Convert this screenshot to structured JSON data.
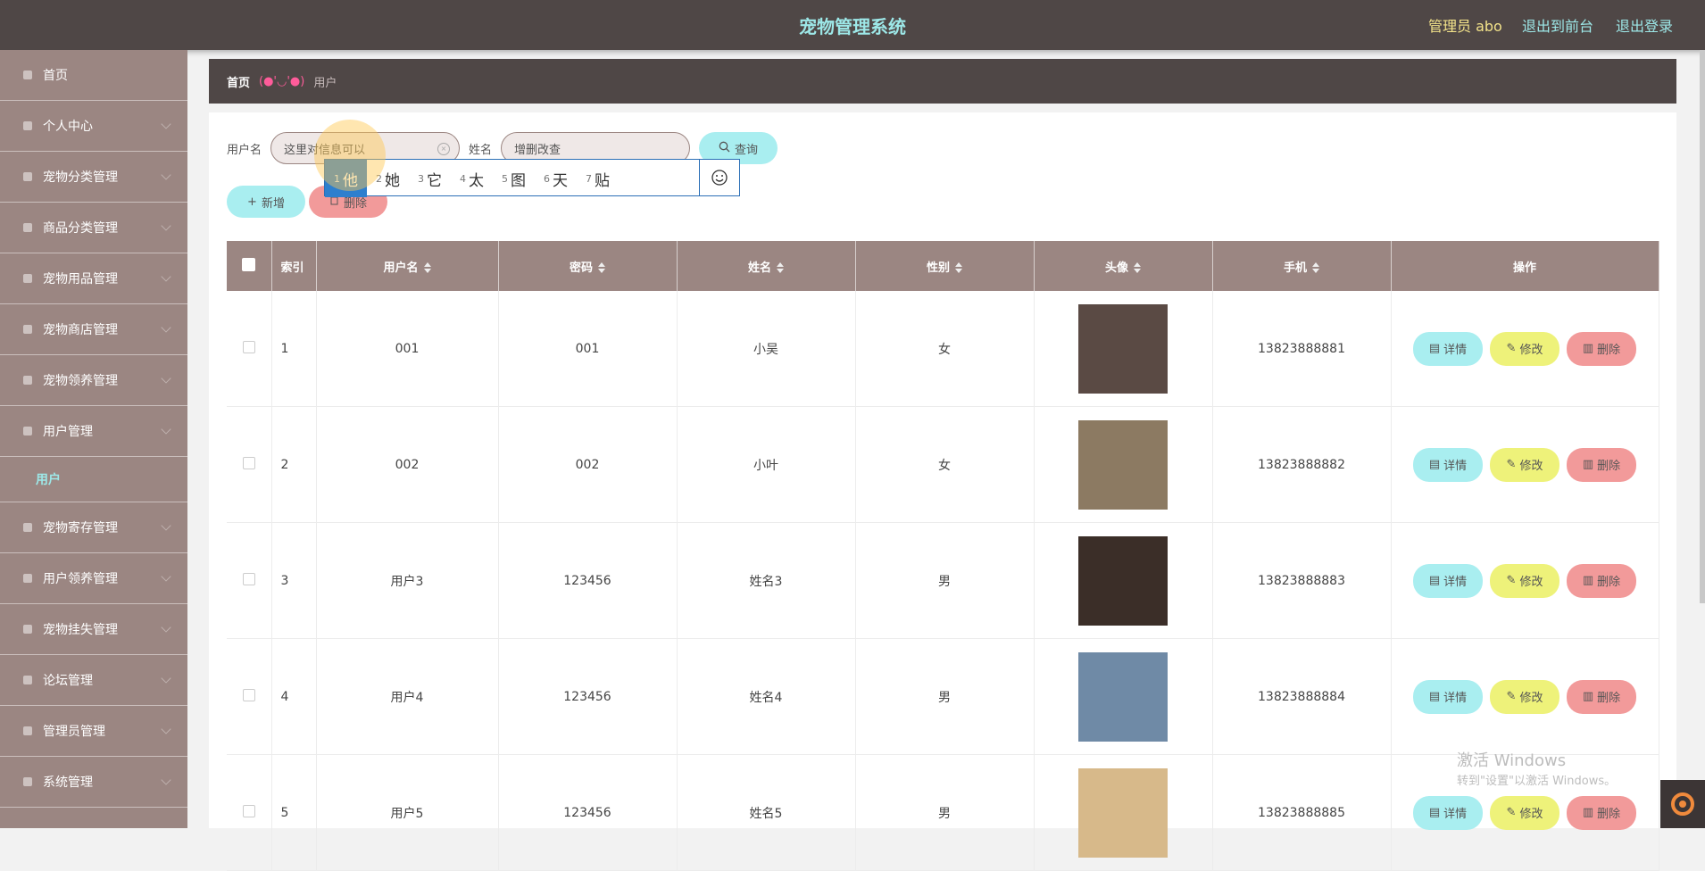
{
  "header": {
    "title": "宠物管理系统",
    "admin_label": "管理员 abo",
    "front_link": "退出到前台",
    "logout_link": "退出登录"
  },
  "sidebar": {
    "items": [
      {
        "label": "首页",
        "icon": "home-icon"
      },
      {
        "label": "个人中心",
        "icon": "user-icon"
      },
      {
        "label": "宠物分类管理",
        "icon": "message-icon"
      },
      {
        "label": "商品分类管理",
        "icon": "grid-icon"
      },
      {
        "label": "宠物用品管理",
        "icon": "folder-icon"
      },
      {
        "label": "宠物商店管理",
        "icon": "list-icon"
      },
      {
        "label": "宠物领养管理",
        "icon": "grid-icon"
      },
      {
        "label": "用户管理",
        "icon": "send-icon"
      },
      {
        "label": "宠物寄存管理",
        "icon": "message-icon"
      },
      {
        "label": "用户领养管理",
        "icon": "circle-icon"
      },
      {
        "label": "宠物挂失管理",
        "icon": "user-icon"
      },
      {
        "label": "论坛管理",
        "icon": "list-icon"
      },
      {
        "label": "管理员管理",
        "icon": "send-icon"
      },
      {
        "label": "系统管理",
        "icon": "list-icon"
      }
    ],
    "sub_item": "用户"
  },
  "breadcrumb": {
    "home": "首页",
    "face": "(●'◡'●)",
    "current": "用户"
  },
  "search": {
    "username_label": "用户名",
    "username_value": "这里对信息可以",
    "name_label": "姓名",
    "name_value": "增删改查",
    "query_button": "查询"
  },
  "actions": {
    "add": "新增",
    "delete": "删除"
  },
  "ime": {
    "candidates": [
      {
        "n": "1",
        "c": "他"
      },
      {
        "n": "2",
        "c": "她"
      },
      {
        "n": "3",
        "c": "它"
      },
      {
        "n": "4",
        "c": "太"
      },
      {
        "n": "5",
        "c": "图"
      },
      {
        "n": "6",
        "c": "天"
      },
      {
        "n": "7",
        "c": "贴"
      }
    ],
    "selected_index": 0
  },
  "table": {
    "columns": [
      "索引",
      "用户名",
      "密码",
      "姓名",
      "性别",
      "头像",
      "手机",
      "操作"
    ],
    "rows": [
      {
        "index": "1",
        "username": "001",
        "password": "001",
        "name": "小吴",
        "gender": "女",
        "phone": "13823888881",
        "avatar_color": "#5a4a44"
      },
      {
        "index": "2",
        "username": "002",
        "password": "002",
        "name": "小叶",
        "gender": "女",
        "phone": "13823888882",
        "avatar_color": "#8c7a62"
      },
      {
        "index": "3",
        "username": "用户3",
        "password": "123456",
        "name": "姓名3",
        "gender": "男",
        "phone": "13823888883",
        "avatar_color": "#3b2e28"
      },
      {
        "index": "4",
        "username": "用户4",
        "password": "123456",
        "name": "姓名4",
        "gender": "男",
        "phone": "13823888884",
        "avatar_color": "#6f8aa6"
      },
      {
        "index": "5",
        "username": "用户5",
        "password": "123456",
        "name": "姓名5",
        "gender": "男",
        "phone": "13823888885",
        "avatar_color": "#d7b98a"
      }
    ],
    "op_labels": {
      "detail": "详情",
      "edit": "修改",
      "delete": "删除"
    }
  },
  "watermark": {
    "title": "激活 Windows",
    "sub": "转到\"设置\"以激活 Windows。"
  }
}
